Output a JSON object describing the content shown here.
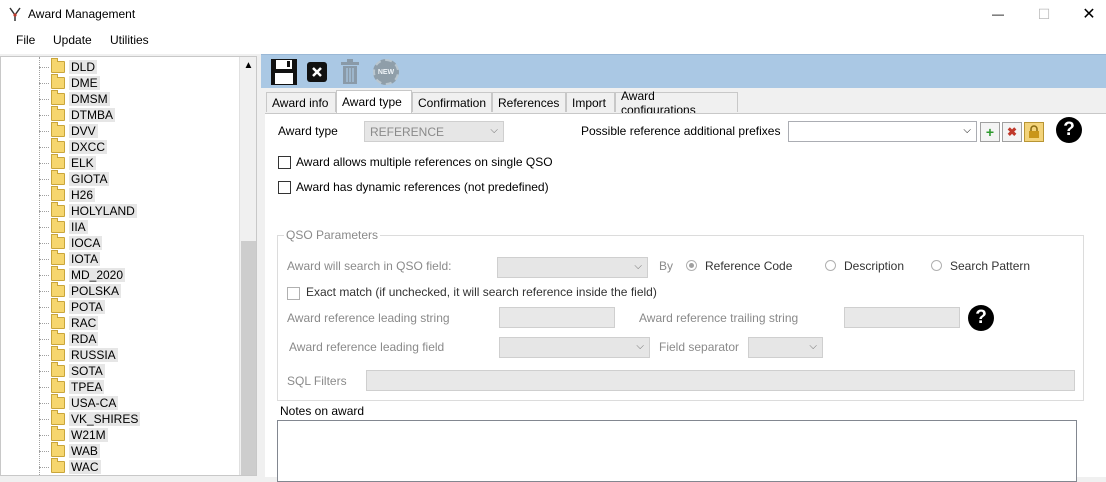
{
  "window": {
    "title": "Award Management",
    "minimize_glyph": "—",
    "maximize_glyph": "☐",
    "close_glyph": "✕"
  },
  "menu": [
    "File",
    "Update",
    "Utilities"
  ],
  "tree": {
    "items": [
      "DLD",
      "DME",
      "DMSM",
      "DTMBA",
      "DVV",
      "DXCC",
      "ELK",
      "GIOTA",
      "H26",
      "HOLYLAND",
      "IIA",
      "IOCA",
      "IOTA",
      "MD_2020",
      "POLSKA",
      "POTA",
      "RAC",
      "RDA",
      "RUSSIA",
      "SOTA",
      "TPEA",
      "USA-CA",
      "VK_SHIRES",
      "W21M",
      "WAB",
      "WAC"
    ],
    "scroll_up_glyph": "▲"
  },
  "toolbar": {
    "save_icon": "floppy-disk",
    "cancel_icon": "close-box",
    "delete_icon": "trash-can",
    "new_label": "NEW"
  },
  "tabs": [
    "Award info",
    "Award type",
    "Confirmation",
    "References",
    "Import",
    "Award configurations"
  ],
  "active_tab": "Award type",
  "form": {
    "award_type_label": "Award type",
    "award_type_value": "REFERENCE",
    "prefixes_label": "Possible reference additional prefixes",
    "prefixes_value": "",
    "add_glyph": "+",
    "remove_glyph": "✖",
    "lock_glyph": "🔒",
    "help_glyph": "?",
    "multi_refs_label": "Award allows multiple references on single QSO",
    "dynamic_refs_label": "Award has dynamic references (not predefined)",
    "qso_group_title": "QSO Parameters",
    "search_field_label": "Award will search in QSO field:",
    "by_label": "By",
    "radio_ref_code": "Reference Code",
    "radio_description": "Description",
    "radio_search_pattern": "Search Pattern",
    "exact_match_label": "Exact match (if unchecked, it will search reference inside the field)",
    "leading_string_label": "Award reference leading string",
    "trailing_string_label": "Award reference trailing string",
    "leading_field_label": "Award reference leading field",
    "field_separator_label": "Field separator",
    "sql_filters_label": "SQL Filters",
    "notes_label": "Notes on award",
    "arrow_glyph": "⌵"
  }
}
